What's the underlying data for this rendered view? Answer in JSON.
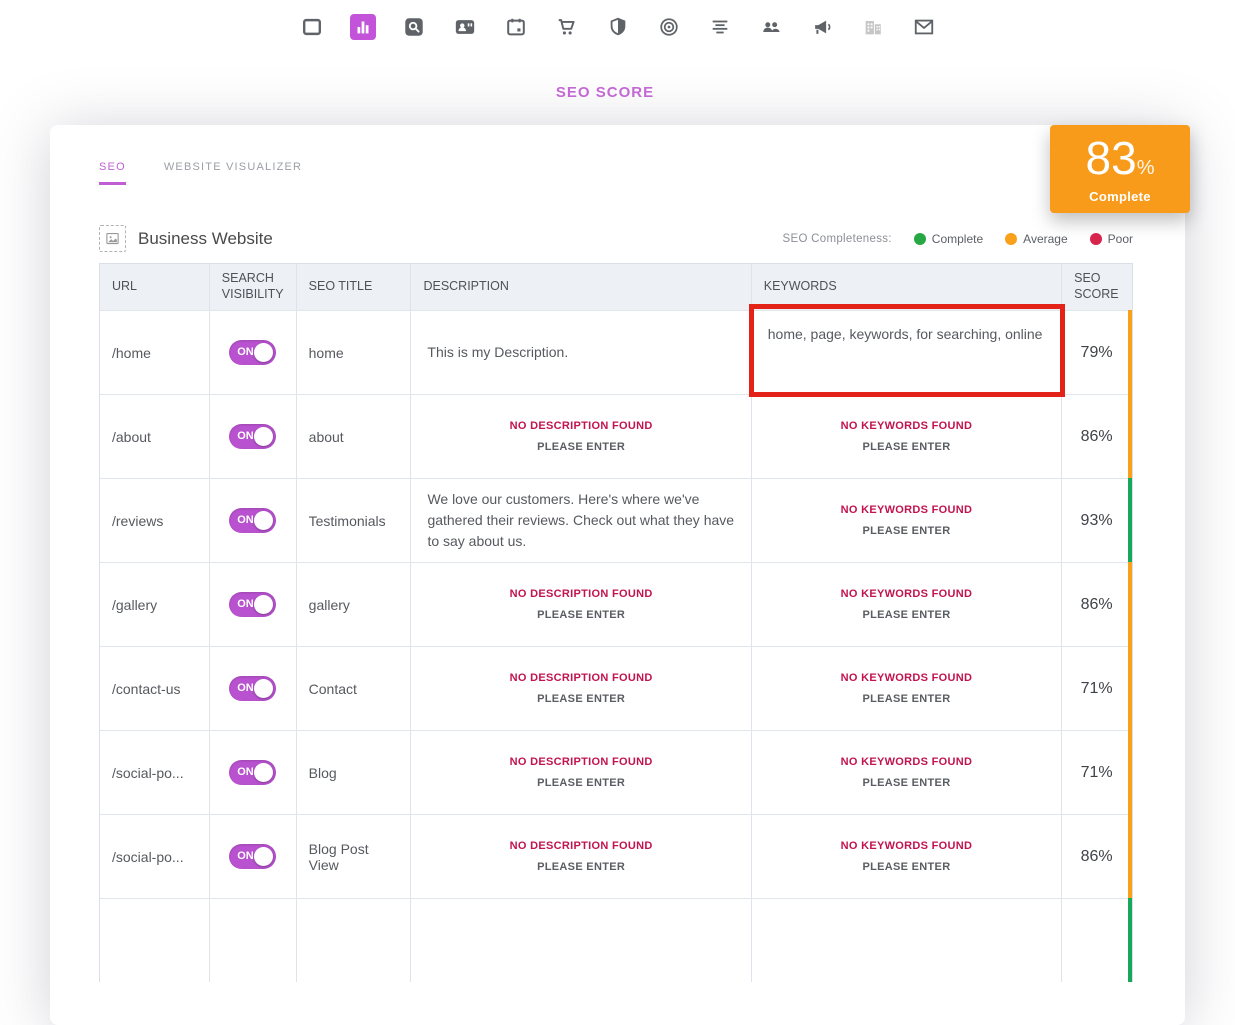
{
  "page": {
    "title": "SEO SCORE"
  },
  "toolbar": {
    "icons": [
      {
        "name": "website",
        "active": false
      },
      {
        "name": "analytics",
        "active": true
      },
      {
        "name": "seo-search",
        "active": false
      },
      {
        "name": "contacts",
        "active": false
      },
      {
        "name": "calendar",
        "active": false
      },
      {
        "name": "store",
        "active": false
      },
      {
        "name": "security",
        "active": false
      },
      {
        "name": "goals",
        "active": false
      },
      {
        "name": "content",
        "active": false
      },
      {
        "name": "team",
        "active": false
      },
      {
        "name": "marketing",
        "active": false
      },
      {
        "name": "building",
        "active": false
      },
      {
        "name": "email",
        "active": false
      }
    ]
  },
  "tabs": [
    {
      "label": "SEO",
      "active": true
    },
    {
      "label": "WEBSITE VISUALIZER",
      "active": false
    }
  ],
  "badge": {
    "score": "83",
    "unit": "%",
    "label": "Complete",
    "color": "#F89B1B"
  },
  "site": {
    "name": "Business Website"
  },
  "legend": {
    "caption": "SEO Completeness:",
    "items": [
      {
        "label": "Complete",
        "color": "#28A745"
      },
      {
        "label": "Average",
        "color": "#F9A11B"
      },
      {
        "label": "Poor",
        "color": "#D6244A"
      }
    ]
  },
  "table": {
    "headers": {
      "url": "URL",
      "visibility": "SEARCH VISIBILITY",
      "seo_title": "SEO TITLE",
      "description": "DESCRIPTION",
      "keywords": "KEYWORDS",
      "score": "SEO SCORE"
    },
    "toggle_on_label": "ON",
    "missing_description": {
      "line1": "NO DESCRIPTION FOUND",
      "line2": "PLEASE ENTER"
    },
    "missing_keywords": {
      "line1": "NO KEYWORDS FOUND",
      "line2": "PLEASE ENTER"
    },
    "rows": [
      {
        "url": "/home",
        "seo_title": "home",
        "description": "This is my Description.",
        "keywords": "home, page, keywords, for searching, online",
        "score": "79%",
        "bar_color": "#F9A11B"
      },
      {
        "url": "/about",
        "seo_title": "about",
        "description": "",
        "keywords": "",
        "score": "86%",
        "bar_color": "#F9A11B"
      },
      {
        "url": "/reviews",
        "seo_title": "Testimonials",
        "description": "We love our customers. Here's where we've gathered their reviews. Check out what they have to say about us.",
        "keywords": "",
        "score": "93%",
        "bar_color": "#17A85B"
      },
      {
        "url": "/gallery",
        "seo_title": "gallery",
        "description": "",
        "keywords": "",
        "score": "86%",
        "bar_color": "#F9A11B"
      },
      {
        "url": "/contact-us",
        "seo_title": "Contact",
        "description": "",
        "keywords": "",
        "score": "71%",
        "bar_color": "#F9A11B"
      },
      {
        "url": "/social-po...",
        "seo_title": "Blog",
        "description": "",
        "keywords": "",
        "score": "71%",
        "bar_color": "#F9A11B"
      },
      {
        "url": "/social-po...",
        "seo_title": "Blog Post View",
        "description": "",
        "keywords": "",
        "score": "86%",
        "bar_color": "#F9A11B"
      },
      {
        "url": "",
        "seo_title": "",
        "description": "",
        "keywords": "",
        "score": "",
        "bar_color": "#17A85B"
      }
    ]
  },
  "annotation": {
    "color": "#E42318"
  }
}
